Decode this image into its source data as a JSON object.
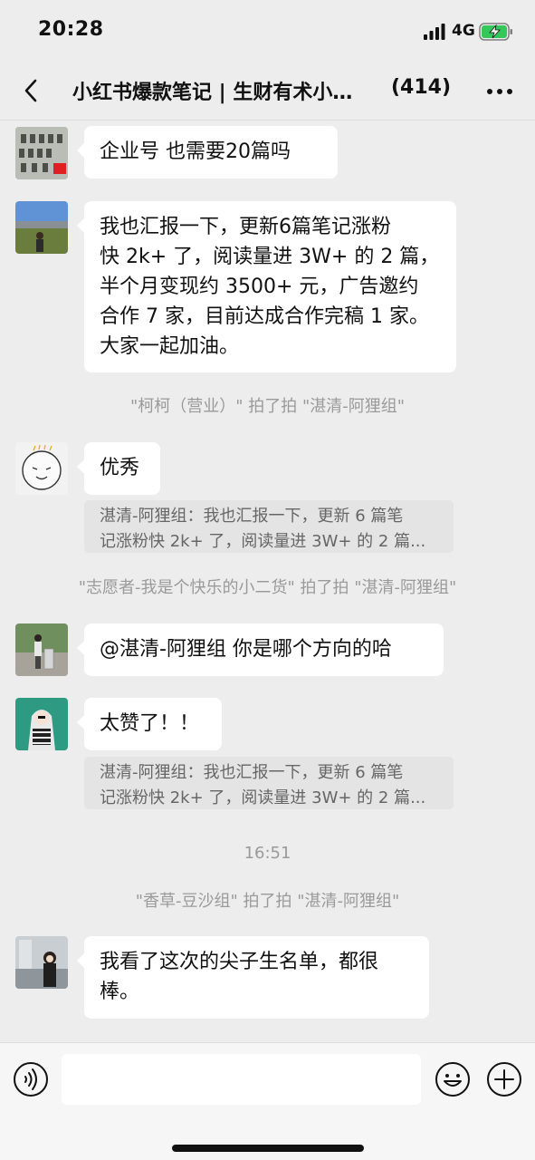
{
  "status_bar": {
    "time": "20:28",
    "network": "4G",
    "icons": [
      "signal-icon",
      "battery-charging-icon"
    ]
  },
  "nav": {
    "title": "小红书爆款笔记 | 生财有术小…",
    "member_count": "(414)",
    "icons": [
      "back-chevron-icon",
      "more-dots-icon"
    ]
  },
  "messages": [
    {
      "type": "text",
      "lines": [
        "企业号  也需要20篇吗"
      ]
    },
    {
      "type": "text",
      "lines": [
        "我也汇报一下，更新6篇笔记涨粉",
        "快 2k+ 了，阅读量进 3W+ 的 2 篇，",
        "半个月变现约 3500+ 元，广告邀约",
        "合作 7 家，目前达成合作完稿 1 家。",
        "大家一起加油。"
      ]
    },
    {
      "type": "system",
      "text": "\"柯柯（营业）\" 拍了拍 \"湛清-阿狸组\""
    },
    {
      "type": "text",
      "lines": [
        "优秀"
      ],
      "quote": [
        "湛清-阿狸组：我也汇报一下，更新 6 篇笔",
        "记涨粉快 2k+ 了，阅读量进 3W+ 的 2 篇..."
      ]
    },
    {
      "type": "system",
      "text": "\"志愿者-我是个快乐的小二货\" 拍了拍 \"湛清-阿狸组\""
    },
    {
      "type": "text",
      "lines": [
        "@湛清-阿狸组 你是哪个方向的哈"
      ]
    },
    {
      "type": "text",
      "lines": [
        "太赞了！！"
      ],
      "quote": [
        "湛清-阿狸组：我也汇报一下，更新 6 篇笔",
        "记涨粉快 2k+ 了，阅读量进 3W+ 的 2 篇..."
      ]
    },
    {
      "type": "time",
      "text": "16:51"
    },
    {
      "type": "system",
      "text": "\"香草-豆沙组\" 拍了拍 \"湛清-阿狸组\""
    },
    {
      "type": "text",
      "lines": [
        "我看了这次的尖子生名单，都很",
        "棒。"
      ]
    }
  ],
  "input_bar": {
    "placeholder": "",
    "icons": [
      "voice-icon",
      "emoji-icon",
      "plus-icon"
    ]
  },
  "colors": {
    "background": "#ededed",
    "bubble": "#ffffff",
    "quote": "#e4e4e4",
    "system_text": "#9a9a9a",
    "battery": "#34c759"
  }
}
